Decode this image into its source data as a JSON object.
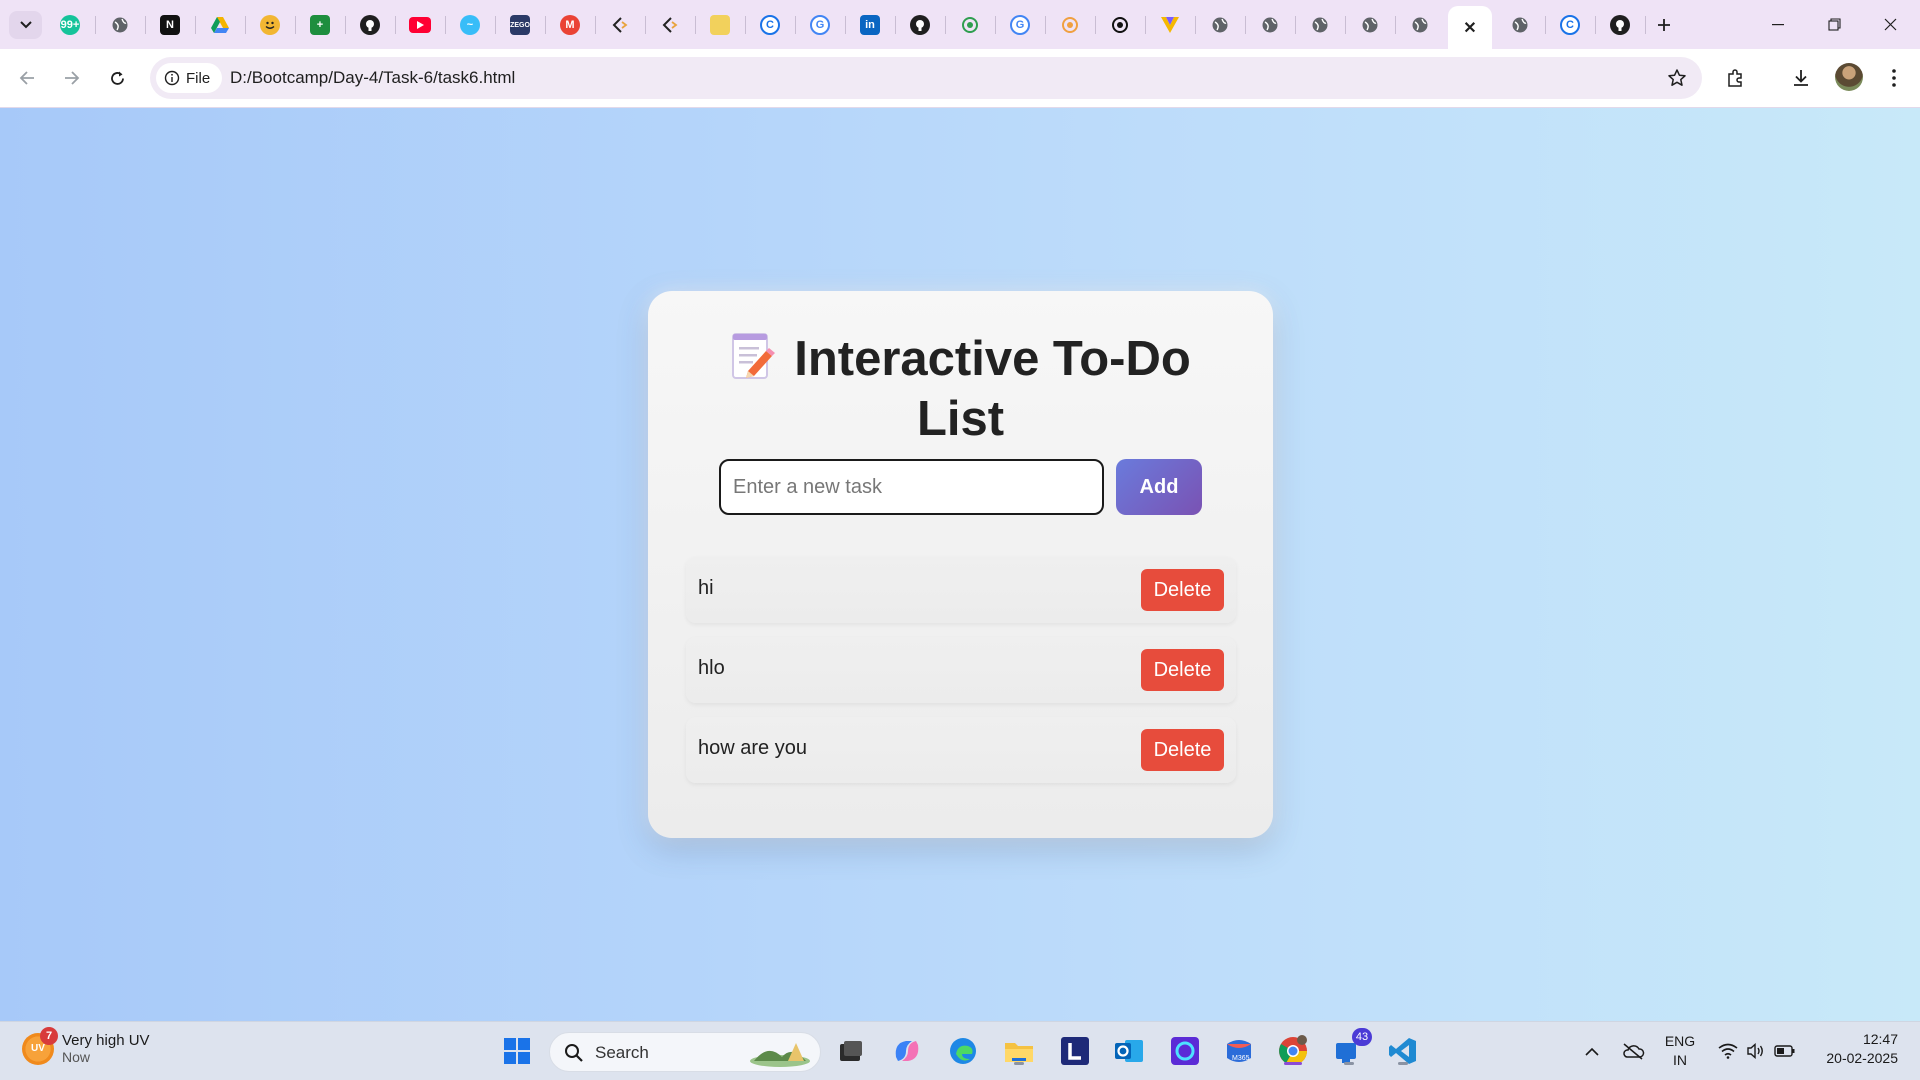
{
  "browser": {
    "tabs": [
      {
        "icon": "grammarly-icon",
        "color": "#15c39a",
        "glyph": "99+"
      },
      {
        "icon": "globe-icon",
        "color": "#5f6368",
        "glyph": ""
      },
      {
        "icon": "notion-icon",
        "color": "#111111",
        "glyph": "N"
      },
      {
        "icon": "google-drive-icon",
        "color": "#f4b400",
        "glyph": ""
      },
      {
        "icon": "emoji-icon",
        "color": "#f2b632",
        "glyph": ""
      },
      {
        "icon": "google-sheets-icon",
        "color": "#1e8e3e",
        "glyph": "+"
      },
      {
        "icon": "github-icon",
        "color": "#1f1f1f",
        "glyph": ""
      },
      {
        "icon": "youtube-icon",
        "color": "#ff0033",
        "glyph": ""
      },
      {
        "icon": "tailwind-icon",
        "color": "#38bdf8",
        "glyph": "~"
      },
      {
        "icon": "zego-icon",
        "color": "#2b3a67",
        "glyph": "ZEGO"
      },
      {
        "icon": "gmail-icon",
        "color": "#ea4335",
        "glyph": "M"
      },
      {
        "icon": "code-icon",
        "color": "#444444",
        "glyph": ""
      },
      {
        "icon": "code-icon",
        "color": "#444444",
        "glyph": ""
      },
      {
        "icon": "person-icon",
        "color": "#f2d15c",
        "glyph": ""
      },
      {
        "icon": "c-icon",
        "color": "#1a73e8",
        "glyph": "C"
      },
      {
        "icon": "google-icon",
        "color": "#4285f4",
        "glyph": "G"
      },
      {
        "icon": "linkedin-icon",
        "color": "#0a66c2",
        "glyph": "in"
      },
      {
        "icon": "github-icon",
        "color": "#1f1f1f",
        "glyph": ""
      },
      {
        "icon": "umbrella-icon",
        "color": "#2e9e4f",
        "glyph": ""
      },
      {
        "icon": "google-icon",
        "color": "#4285f4",
        "glyph": "G"
      },
      {
        "icon": "swirl-icon",
        "color": "#f0a040",
        "glyph": ""
      },
      {
        "icon": "openai-icon",
        "color": "#111111",
        "glyph": ""
      },
      {
        "icon": "v-icon",
        "color": "#7c5cff",
        "glyph": "V"
      },
      {
        "icon": "globe-icon",
        "color": "#5f6368",
        "glyph": ""
      },
      {
        "icon": "globe-icon",
        "color": "#5f6368",
        "glyph": ""
      },
      {
        "icon": "globe-icon",
        "color": "#5f6368",
        "glyph": ""
      },
      {
        "icon": "globe-icon",
        "color": "#5f6368",
        "glyph": ""
      },
      {
        "icon": "globe-icon",
        "color": "#5f6368",
        "glyph": ""
      },
      {
        "icon": "close-icon",
        "color": "#1f1f1f",
        "glyph": "✕",
        "active": true
      },
      {
        "icon": "globe-icon",
        "color": "#5f6368",
        "glyph": ""
      },
      {
        "icon": "edge-copilot-icon",
        "color": "#1a73e8",
        "glyph": "C"
      },
      {
        "icon": "github-icon",
        "color": "#1f1f1f",
        "glyph": ""
      }
    ],
    "address": {
      "chip_label": "File",
      "url": "D:/Bootcamp/Day-4/Task-6/task6.html"
    }
  },
  "page": {
    "title": "Interactive To-Do List",
    "title_icon": "memo-icon",
    "input_placeholder": "Enter a new task",
    "add_label": "Add",
    "tasks": [
      {
        "text": "hi",
        "delete_label": "Delete"
      },
      {
        "text": "hlo",
        "delete_label": "Delete"
      },
      {
        "text": "how are you",
        "delete_label": "Delete"
      }
    ],
    "colors": {
      "delete": "#e74c3c",
      "add_gradient_start": "#6a7bdc",
      "add_gradient_end": "#7a52b3"
    }
  },
  "taskbar": {
    "weather": {
      "badge": "7",
      "icon_label": "UV",
      "line1": "Very high UV",
      "line2": "Now"
    },
    "search_label": "Search",
    "apps": [
      {
        "name": "start-icon"
      },
      {
        "name": "task-view-icon"
      },
      {
        "name": "copilot-icon"
      },
      {
        "name": "edge-icon"
      },
      {
        "name": "file-explorer-icon"
      },
      {
        "name": "l-app-icon"
      },
      {
        "name": "outlook-icon"
      },
      {
        "name": "circle-app-icon"
      },
      {
        "name": "m365-icon"
      },
      {
        "name": "chrome-icon"
      },
      {
        "name": "teams-icon",
        "badge": "43"
      },
      {
        "name": "vscode-icon"
      }
    ],
    "tray": {
      "lang_line1": "ENG",
      "lang_line2": "IN",
      "time": "12:47",
      "date": "20-02-2025"
    }
  }
}
